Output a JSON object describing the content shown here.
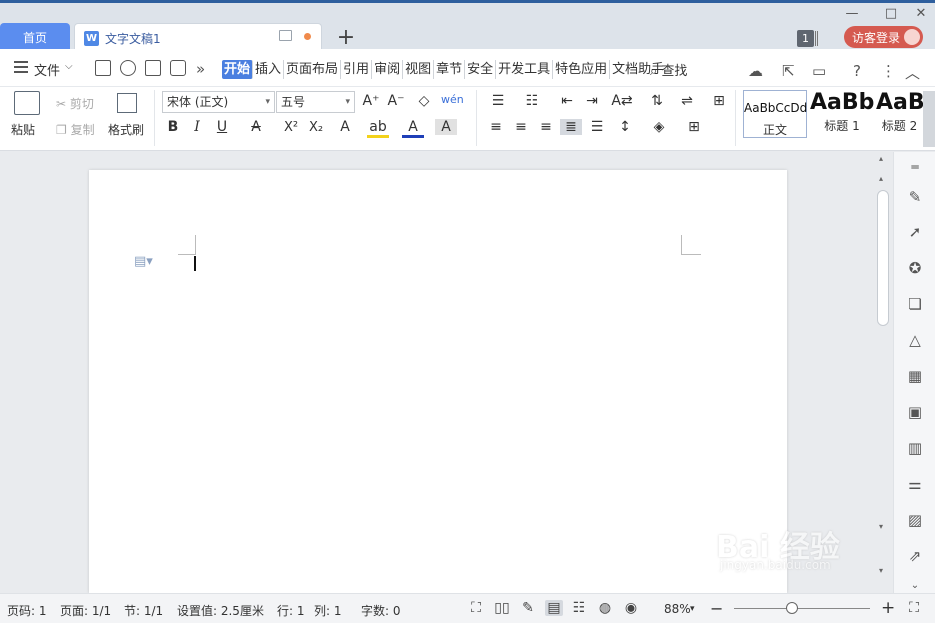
{
  "tabs": {
    "home_label": "首页",
    "doc_icon": "W",
    "doc_label": "文字文稿1",
    "new_tab_icon": "+"
  },
  "window": {
    "minimize_icon": "—",
    "maximize_icon": "□",
    "close_icon": "✕",
    "notification_count": "1",
    "login_label": "访客登录"
  },
  "menubar": {
    "file_label": "文件",
    "more_icon": "»",
    "tabs": [
      {
        "label": "开始",
        "active": true
      },
      {
        "label": "插入"
      },
      {
        "label": "页面布局"
      },
      {
        "label": "引用"
      },
      {
        "label": "审阅"
      },
      {
        "label": "视图"
      },
      {
        "label": "章节"
      },
      {
        "label": "安全"
      },
      {
        "label": "开发工具"
      },
      {
        "label": "特色应用"
      },
      {
        "label": "文档助手"
      }
    ],
    "search_label": "查找"
  },
  "ribbon": {
    "paste_label": "粘贴",
    "cut_label": "剪切",
    "copy_label": "复制",
    "format_painter_label": "格式刷",
    "font_name": "宋体 (正文)",
    "font_size": "五号",
    "bold": "B",
    "italic": "I",
    "underline": "U",
    "strike": "A",
    "superscript": "X²",
    "subscript": "X₂",
    "grow_font": "A⁺",
    "shrink_font": "A⁻",
    "pinyin": "wén",
    "styles": [
      {
        "sample": "AaBbCcDd",
        "name": "正文"
      },
      {
        "sample": "AaBb",
        "name": "标题 1"
      },
      {
        "sample": "AaBl",
        "name": "标题 2"
      }
    ]
  },
  "statusbar": {
    "page_number": "页码: 1",
    "pages": "页面: 1/1",
    "section": "节: 1/1",
    "setting": "设置值: 2.5厘米",
    "row": "行: 1",
    "col": "列: 1",
    "word_count": "字数: 0",
    "zoom": "88%",
    "zoom_level": 0.43
  },
  "watermark": {
    "main": "Bai 经验",
    "sub": "jingyan.baidu.com"
  }
}
